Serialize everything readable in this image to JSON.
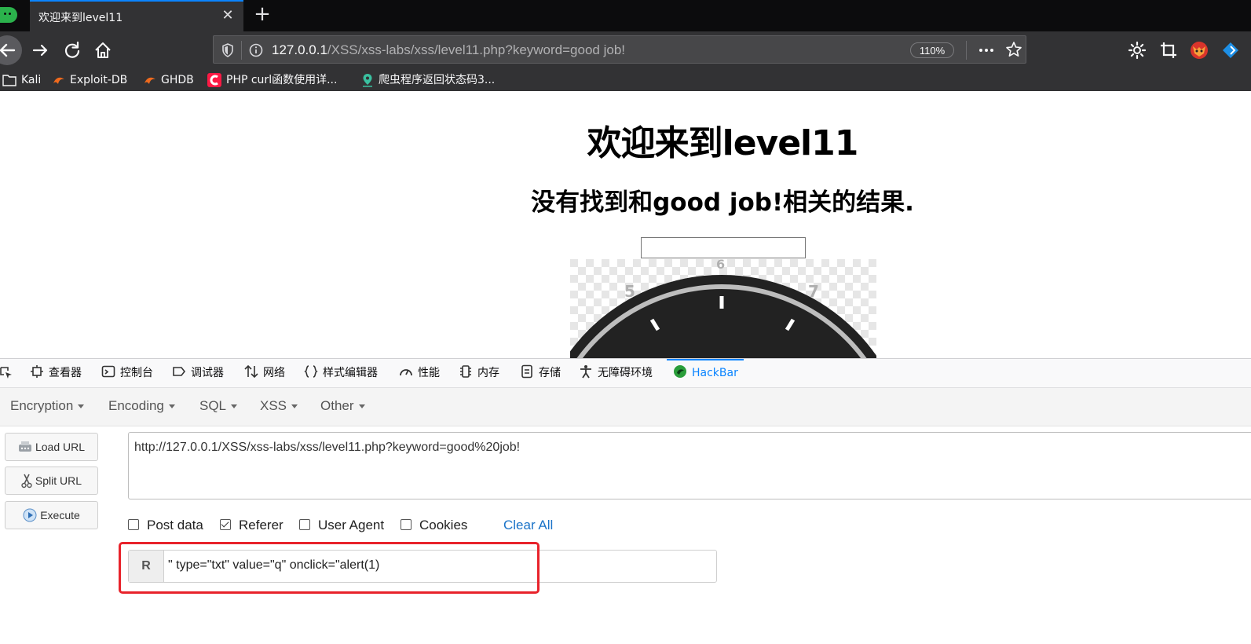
{
  "browser": {
    "tab_title": "欢迎来到level11",
    "tab_close_glyph": "✕",
    "new_tab_glyph": "+",
    "url_host": "127.0.0.1",
    "url_path": "/XSS/xss-labs/xss/level11.php?keyword=good job!",
    "zoom": "110%",
    "bookmarks": [
      {
        "label": "Kali",
        "icon": "folder-icon"
      },
      {
        "label": "Exploit-DB",
        "icon": "kali-dragon-icon"
      },
      {
        "label": "GHDB",
        "icon": "kali-dragon-icon"
      },
      {
        "label": "PHP curl函数使用详...",
        "icon": "csdn-icon"
      },
      {
        "label": "爬虫程序返回状态码3...",
        "icon": "map-pin-icon"
      }
    ]
  },
  "page": {
    "heading": "欢迎来到level11",
    "subheading": "没有找到和good job!相关的结果.",
    "input_value": ""
  },
  "devtools": {
    "tabs": [
      {
        "label": "查看器",
        "icon": "inspector-icon"
      },
      {
        "label": "控制台",
        "icon": "console-icon"
      },
      {
        "label": "调试器",
        "icon": "debugger-icon"
      },
      {
        "label": "网络",
        "icon": "network-icon"
      },
      {
        "label": "样式编辑器",
        "icon": "braces-icon"
      },
      {
        "label": "性能",
        "icon": "performance-icon"
      },
      {
        "label": "内存",
        "icon": "memory-icon"
      },
      {
        "label": "存储",
        "icon": "storage-icon"
      },
      {
        "label": "无障碍环境",
        "icon": "accessibility-icon"
      },
      {
        "label": "HackBar",
        "icon": "hackbar-icon",
        "active": true
      }
    ]
  },
  "hackbar": {
    "menu": [
      "Encryption",
      "Encoding",
      "SQL",
      "XSS",
      "Other"
    ],
    "load_url": "Load URL",
    "split_url": "Split URL",
    "execute": "Execute",
    "url_value": "http://127.0.0.1/XSS/xss-labs/xss/level11.php?keyword=good%20job!",
    "options": [
      {
        "label": "Post data",
        "checked": false
      },
      {
        "label": "Referer",
        "checked": true
      },
      {
        "label": "User Agent",
        "checked": false
      },
      {
        "label": "Cookies",
        "checked": false
      }
    ],
    "clear_all": "Clear All",
    "referer_label": "R",
    "referer_value": "\" type=\"txt\" value=\"q\" onclick=\"alert(1)"
  },
  "colors": {
    "accent": "#0a84ff",
    "highlight": "#e8232b",
    "link": "#1a73c8"
  }
}
